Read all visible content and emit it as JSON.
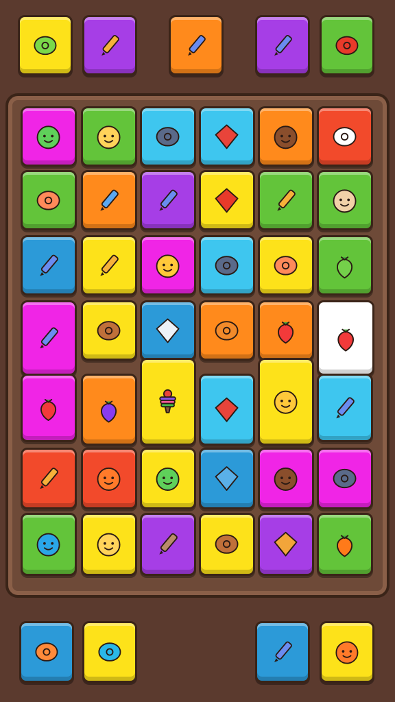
{
  "colors": {
    "yellow": "#fde21a",
    "purple": "#a63ee6",
    "orange": "#ff8a1c",
    "green": "#63c43a",
    "magenta": "#f025e6",
    "cyan": "#3ec6ef",
    "red": "#f24a2b",
    "blue": "#2c9ad8",
    "white": "#ffffff",
    "board": "#6e4a38",
    "background": "#5b3a2e"
  },
  "top_tray": [
    {
      "icon": "leaf-bowl-icon",
      "color": "yellow"
    },
    {
      "icon": "pencil-icon",
      "color": "purple"
    },
    {
      "icon": "popsicle-icon",
      "color": "orange"
    },
    {
      "icon": "paintbrush-icon",
      "color": "purple"
    },
    {
      "icon": "sausage-icon",
      "color": "green"
    }
  ],
  "board_tiles": [
    {
      "icon": "ghost-icon",
      "color": "magenta"
    },
    {
      "icon": "lion-face-icon",
      "color": "green"
    },
    {
      "icon": "ring-icon",
      "color": "cyan"
    },
    {
      "icon": "flag-icon",
      "color": "cyan"
    },
    {
      "icon": "acorn-face-icon",
      "color": "orange"
    },
    {
      "icon": "ram-trophy-icon",
      "color": "red"
    },
    {
      "icon": "speech-bubble-icon",
      "color": "green"
    },
    {
      "icon": "rocket-icon",
      "color": "orange"
    },
    {
      "icon": "telescope-icon",
      "color": "purple"
    },
    {
      "icon": "gem-icon",
      "color": "yellow"
    },
    {
      "icon": "crayon-icon",
      "color": "green"
    },
    {
      "icon": "bear-face-icon",
      "color": "green"
    },
    {
      "icon": "sign-post-icon",
      "color": "blue"
    },
    {
      "icon": "pencil-icon",
      "color": "yellow"
    },
    {
      "icon": "cat-face-icon",
      "color": "magenta"
    },
    {
      "icon": "snail-icon",
      "color": "cyan"
    },
    {
      "icon": "chat-bubble-icon",
      "color": "yellow"
    },
    {
      "icon": "lime-icon",
      "color": "green"
    },
    {
      "icon": "flashlight-icon",
      "color": "magenta"
    },
    {
      "icon": "bread-icon",
      "color": "yellow"
    },
    {
      "icon": "dice-icon",
      "color": "blue"
    },
    {
      "icon": "swirl-icon",
      "color": "orange"
    },
    {
      "icon": "strawberry-icon",
      "color": "orange"
    },
    {
      "icon": "strawberry-icon",
      "color": "white"
    },
    {
      "icon": "chili-icon",
      "color": "magenta"
    },
    {
      "icon": "balloon-icon",
      "color": "orange"
    },
    {
      "icon": "ice-cream-stack-icon",
      "color": "yellow"
    },
    {
      "icon": "kite-icon",
      "color": "cyan"
    },
    {
      "icon": "pawn-face-icon",
      "color": "yellow"
    },
    {
      "icon": "wand-icon",
      "color": "cyan"
    },
    {
      "icon": "crayon-icon",
      "color": "red"
    },
    {
      "icon": "fox-face-icon",
      "color": "red"
    },
    {
      "icon": "frog-icon",
      "color": "yellow"
    },
    {
      "icon": "sign-icon",
      "color": "blue"
    },
    {
      "icon": "cookie-icon",
      "color": "magenta"
    },
    {
      "icon": "snail-shell-icon",
      "color": "magenta"
    },
    {
      "icon": "blue-bird-icon",
      "color": "green"
    },
    {
      "icon": "fluff-face-icon",
      "color": "yellow"
    },
    {
      "icon": "bone-icon",
      "color": "purple"
    },
    {
      "icon": "sweet-potato-icon",
      "color": "yellow"
    },
    {
      "icon": "box-icon",
      "color": "purple"
    },
    {
      "icon": "orange-fruit-icon",
      "color": "green"
    }
  ],
  "bottom_tray": [
    {
      "icon": "flower-icon",
      "color": "blue"
    },
    {
      "icon": "sun-gear-icon",
      "color": "yellow"
    },
    {
      "icon": "brush-icon",
      "color": "blue"
    },
    {
      "icon": "imp-face-icon",
      "color": "yellow"
    }
  ]
}
